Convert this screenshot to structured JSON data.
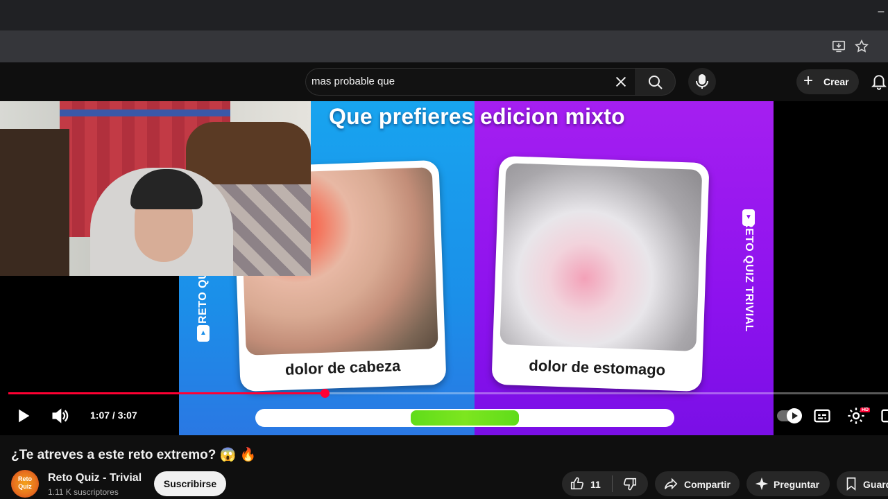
{
  "browser": {
    "minimize_glyph": "–",
    "install_icon": "install-app-icon",
    "bookmark_icon": "star-icon"
  },
  "header": {
    "search_value": "mas probable que",
    "create_label": "Crear",
    "icons": [
      "close-icon",
      "search-icon",
      "microphone-icon",
      "plus-icon",
      "bell-icon"
    ]
  },
  "frame": {
    "title": "Que prefieres edicion mixto",
    "side_label": "RETO QUIZ TRIVIAL",
    "left_card_label": "dolor de cabeza",
    "right_card_label": "dolor de estomago",
    "timer_fraction": 0.26,
    "colors": {
      "left_bg": "#1b8fe9",
      "right_bg": "#8d12ee",
      "timer": "#6ee01c"
    }
  },
  "player": {
    "time_display": "1:07 / 3:07",
    "progress_fraction": 0.36,
    "hd_badge": "HD",
    "accent": "#ff0033"
  },
  "video": {
    "title": "¿Te atreves a este reto extremo? 😱 🔥",
    "channel_name": "Reto Quiz - Trivial",
    "channel_subs": "1.11 K suscriptores",
    "avatar_text": "Reto Quiz",
    "subscribe_label": "Suscribirse",
    "like_count": "11",
    "share_label": "Compartir",
    "ask_label": "Preguntar",
    "save_label": "Guardar"
  }
}
